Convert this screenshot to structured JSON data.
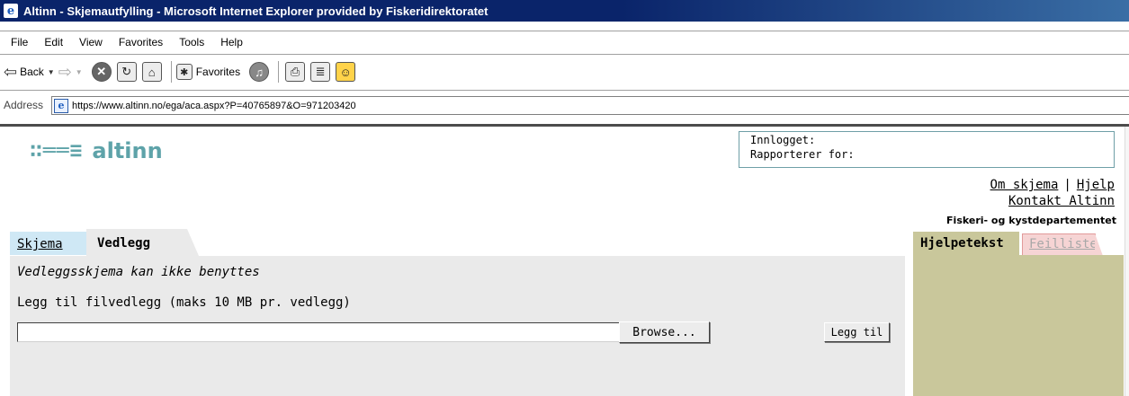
{
  "window": {
    "title": "Altinn - Skjemautfylling - Microsoft Internet Explorer provided by Fiskeridirektoratet"
  },
  "menu": [
    "File",
    "Edit",
    "View",
    "Favorites",
    "Tools",
    "Help"
  ],
  "toolbar": {
    "back_label": "Back",
    "favorites_label": "Favorites",
    "icons": [
      "back-arrow-icon",
      "forward-arrow-icon",
      "stop-icon",
      "refresh-icon",
      "home-icon",
      "search-icon",
      "favorites-icon",
      "media-icon",
      "mail-icon",
      "print-icon",
      "edit-icon",
      "messenger-icon"
    ]
  },
  "address": {
    "label": "Address",
    "url": "https://www.altinn.no/ega/aca.aspx?P=40765897&O=971203420"
  },
  "site": {
    "logo_mark": "∷══≡",
    "logo_text": "altinn",
    "logged_in_label": "Innlogget:",
    "reporting_for_label": "Rapporterer for:",
    "link_about": "Om skjema",
    "link_separator": "|",
    "link_help": "Hjelp",
    "link_contact": "Kontakt Altinn",
    "department": "Fiskeri- og kystdepartementet"
  },
  "tabs": {
    "form": "Skjema",
    "attachments": "Vedlegg"
  },
  "attachments": {
    "notice": "Vedleggsskjema kan ikke benyttes",
    "file_label": "Legg til filvedlegg (maks 10 MB pr. vedlegg)",
    "file_value": "",
    "browse_label": "Browse...",
    "add_label": "Legg til"
  },
  "help_panel": {
    "tab_help": "Hjelpetekst",
    "tab_errors": "Feilliste"
  },
  "colors": {
    "titlebar": "#0a246a",
    "logo": "#5ea3a9",
    "help_panel": "#c9c79b",
    "errors_tab": "#f6d4d4",
    "form_tab": "#cfe8f5",
    "panel": "#eaeaea"
  }
}
